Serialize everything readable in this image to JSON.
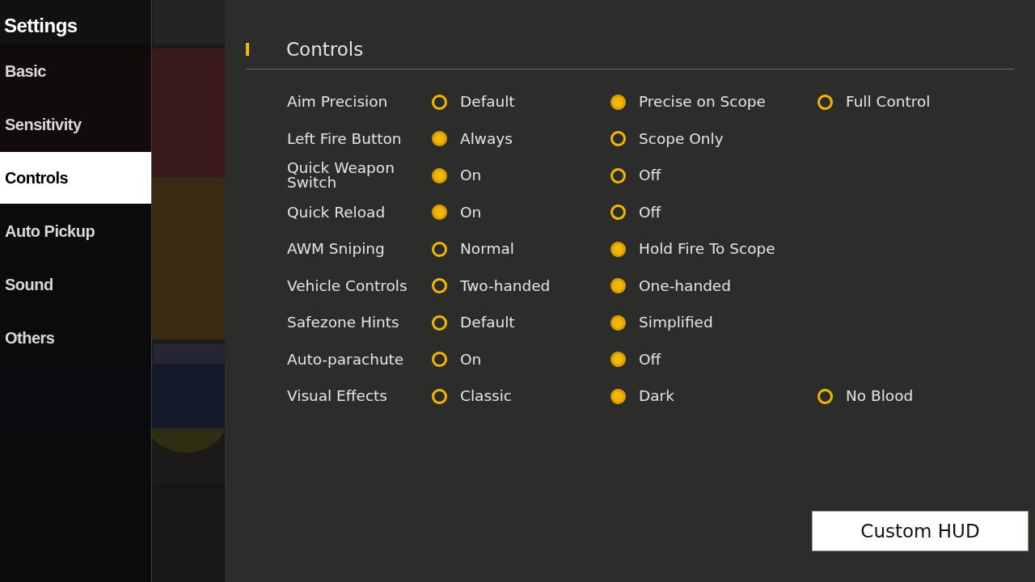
{
  "sidebar": {
    "title": "Settings",
    "items": [
      {
        "label": "Basic",
        "selected": false
      },
      {
        "label": "Sensitivity",
        "selected": false
      },
      {
        "label": "Controls",
        "selected": true
      },
      {
        "label": "Auto Pickup",
        "selected": false
      },
      {
        "label": "Sound",
        "selected": false
      },
      {
        "label": "Others",
        "selected": false
      }
    ]
  },
  "panel": {
    "title": "Controls",
    "settings": [
      {
        "label": "Aim Precision",
        "options": [
          {
            "label": "Default",
            "selected": false
          },
          {
            "label": "Precise on Scope",
            "selected": true
          },
          {
            "label": "Full Control",
            "selected": false
          }
        ]
      },
      {
        "label": "Left Fire Button",
        "options": [
          {
            "label": "Always",
            "selected": true
          },
          {
            "label": "Scope Only",
            "selected": false
          }
        ]
      },
      {
        "label": "Quick Weapon Switch",
        "options": [
          {
            "label": "On",
            "selected": true
          },
          {
            "label": "Off",
            "selected": false
          }
        ]
      },
      {
        "label": "Quick Reload",
        "options": [
          {
            "label": "On",
            "selected": true
          },
          {
            "label": "Off",
            "selected": false
          }
        ]
      },
      {
        "label": "AWM Sniping",
        "options": [
          {
            "label": "Normal",
            "selected": false
          },
          {
            "label": "Hold Fire To Scope",
            "selected": true
          }
        ]
      },
      {
        "label": "Vehicle Controls",
        "options": [
          {
            "label": "Two-handed",
            "selected": false
          },
          {
            "label": "One-handed",
            "selected": true
          }
        ]
      },
      {
        "label": "Safezone Hints",
        "options": [
          {
            "label": "Default",
            "selected": false
          },
          {
            "label": "Simplified",
            "selected": true
          }
        ]
      },
      {
        "label": "Auto-parachute",
        "options": [
          {
            "label": "On",
            "selected": false
          },
          {
            "label": "Off",
            "selected": true
          }
        ]
      },
      {
        "label": "Visual Effects",
        "options": [
          {
            "label": "Classic",
            "selected": false
          },
          {
            "label": "Dark",
            "selected": true
          },
          {
            "label": "No Blood",
            "selected": false
          }
        ]
      }
    ],
    "button": "Custom HUD"
  }
}
